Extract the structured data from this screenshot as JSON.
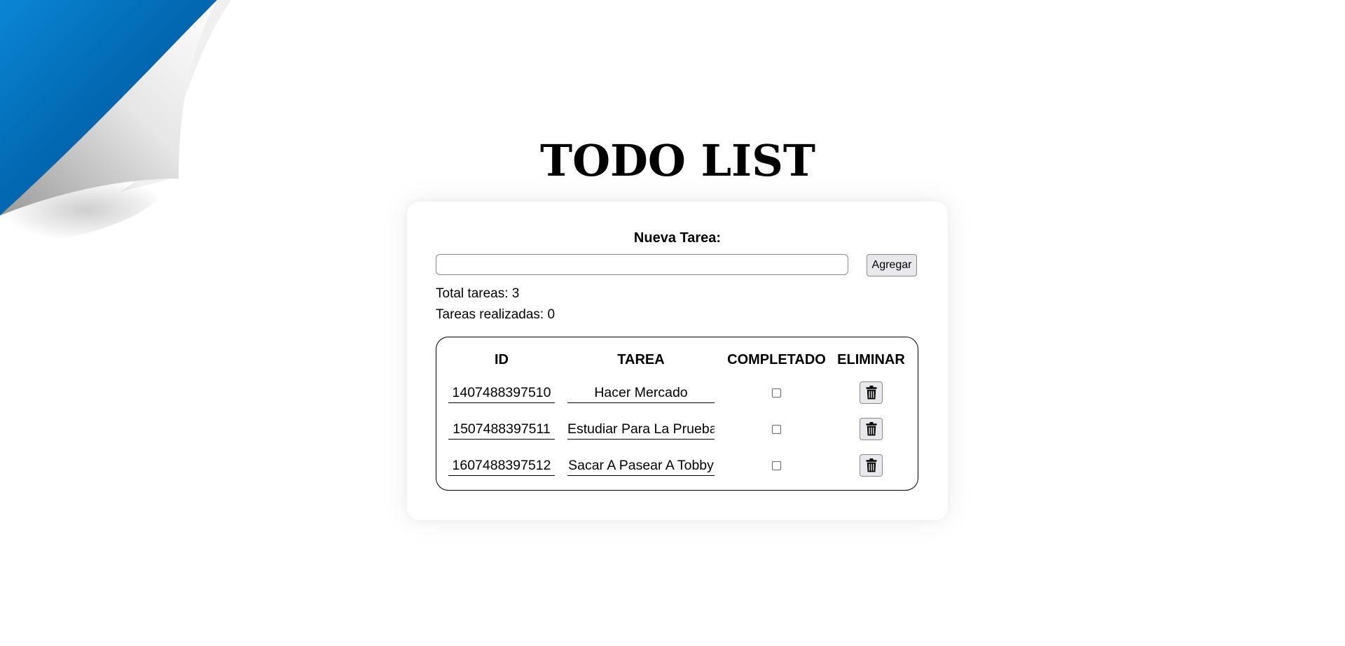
{
  "title": "TODO LIST",
  "form": {
    "label": "Nueva Tarea:",
    "input_value": "",
    "input_placeholder": "",
    "add_button": "Agregar"
  },
  "stats": {
    "total": "Total tareas: 3",
    "done": "Tareas realizadas: 0"
  },
  "table": {
    "headers": {
      "id": "ID",
      "tarea": "TAREA",
      "completado": "COMPLETADO",
      "eliminar": "ELIMINAR"
    },
    "rows": [
      {
        "id": "1407488397510",
        "tarea": "Hacer Mercado",
        "completado": false,
        "delete_icon": "trash-icon"
      },
      {
        "id": "1507488397511",
        "tarea": "Estudiar Para La Prueba",
        "completado": false,
        "delete_icon": "trash-icon"
      },
      {
        "id": "1607488397512",
        "tarea": "Sacar A Pasear A Tobby",
        "completado": false,
        "delete_icon": "trash-icon"
      }
    ]
  },
  "colors": {
    "curl_blue": "#0078c8",
    "curl_dark_blue": "#00509a"
  }
}
